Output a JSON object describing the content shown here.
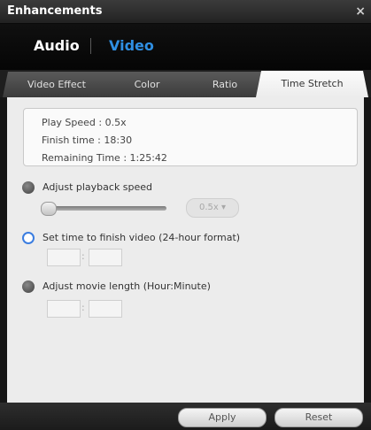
{
  "window": {
    "title": "Enhancements",
    "close_glyph": "×"
  },
  "header": {
    "audio_label": "Audio",
    "video_label": "Video",
    "active": "Video",
    "accent": "#2f8fe3"
  },
  "tabs": [
    {
      "label": "Video Effect"
    },
    {
      "label": "Color"
    },
    {
      "label": "Ratio"
    },
    {
      "label": "Time Stretch"
    }
  ],
  "active_tab": "Time Stretch",
  "info": {
    "play_speed": "Play Speed : 0.5x",
    "finish_time": "Finish time : 18:30",
    "remaining_time": "Remaining Time : 1:25:42"
  },
  "options": {
    "adjust_speed_label": "Adjust playback speed",
    "set_finish_label": "Set time to finish video (24-hour format)",
    "adjust_length_label": "Adjust movie length (Hour:Minute)",
    "selected": "set_finish"
  },
  "speed": {
    "value": "0.5x",
    "arrow_glyph": "▾",
    "slider_position": 0.0
  },
  "finish_time_fields": {
    "hour": "",
    "minute": "",
    "separator": ":"
  },
  "length_fields": {
    "hour": "",
    "minute": "",
    "separator": ":"
  },
  "footer": {
    "apply_label": "Apply",
    "reset_label": "Reset"
  }
}
